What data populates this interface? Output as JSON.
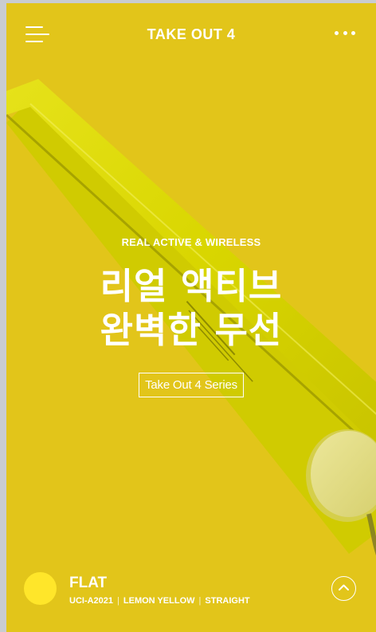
{
  "header": {
    "title": "TAKE OUT 4",
    "menu_icon": "hamburger-icon",
    "more_icon": "more-dots-icon"
  },
  "hero": {
    "eyebrow": "REAL ACTIVE & WIRELESS",
    "headline_line1": "리얼 액티브",
    "headline_line2": "완벽한 무선",
    "cta_label": "Take Out 4 Series"
  },
  "product_info": {
    "name": "FLAT",
    "model": "UCI-A2021",
    "color_name": "LEMON YELLOW",
    "type": "STRAIGHT",
    "swatch_color": "#ffe62a",
    "scroll_top_icon": "chevron-up-icon"
  },
  "theme": {
    "background": "#e2c51a",
    "product_color": "#d8d400",
    "text_color": "#ffffff"
  }
}
